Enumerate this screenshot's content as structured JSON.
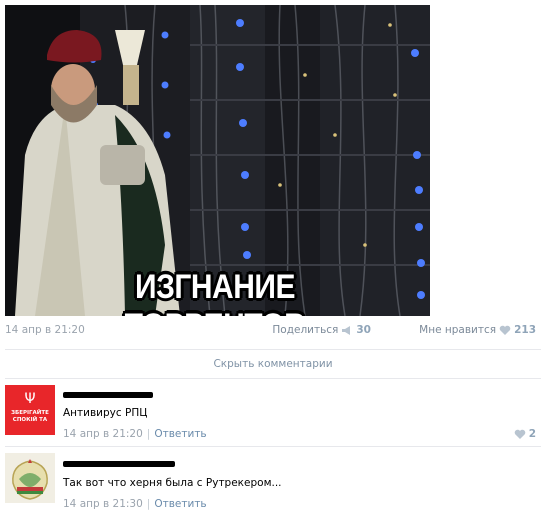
{
  "post": {
    "image_caption": "ИЗГНАНИЕ ТОРРЕНТОВ",
    "date": "14 апр в 21:20",
    "share_label": "Поделиться",
    "share_count": "30",
    "like_label": "Мне нравится",
    "like_count": "213"
  },
  "comments_toggle": "Скрыть комментарии",
  "comments": [
    {
      "avatar_text": "ЗБЕРІГАЙТЕ СПОКІЙ ТА",
      "avatar_icon": "trident-icon",
      "text": "Антивирус РПЦ",
      "date": "14 апр в 21:20",
      "reply_label": "Ответить",
      "like_count": "2"
    },
    {
      "avatar_icon": "emblem-icon",
      "text": "Так вот что херня была с Рутрекером...",
      "date": "14 апр в 21:30",
      "reply_label": "Ответить"
    }
  ],
  "colors": {
    "link": "#6a8bab",
    "muted": "#9aa3ad",
    "divider": "#e7e8ec",
    "avatar_red": "#e8262a"
  }
}
